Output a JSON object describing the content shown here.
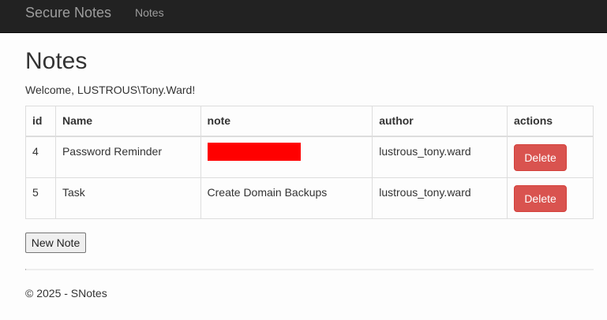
{
  "navbar": {
    "brand": "Secure Notes",
    "links": [
      "Notes"
    ]
  },
  "main": {
    "title": "Notes",
    "welcome": "Welcome, LUSTROUS\\Tony.Ward!",
    "table": {
      "columns": [
        "id",
        "Name",
        "note",
        "author",
        "actions"
      ],
      "rows": [
        {
          "id": "4",
          "name": "Password Reminder",
          "note": "",
          "note_redacted": true,
          "author": "lustrous_tony.ward",
          "action": "Delete"
        },
        {
          "id": "5",
          "name": "Task",
          "note": "Create Domain Backups",
          "note_redacted": false,
          "author": "lustrous_tony.ward",
          "action": "Delete"
        }
      ]
    },
    "new_note_label": "New Note"
  },
  "footer": {
    "text": "© 2025 - SNotes"
  },
  "colors": {
    "navbar_bg": "#222222",
    "danger": "#d9534f",
    "redaction": "#ff0000"
  }
}
